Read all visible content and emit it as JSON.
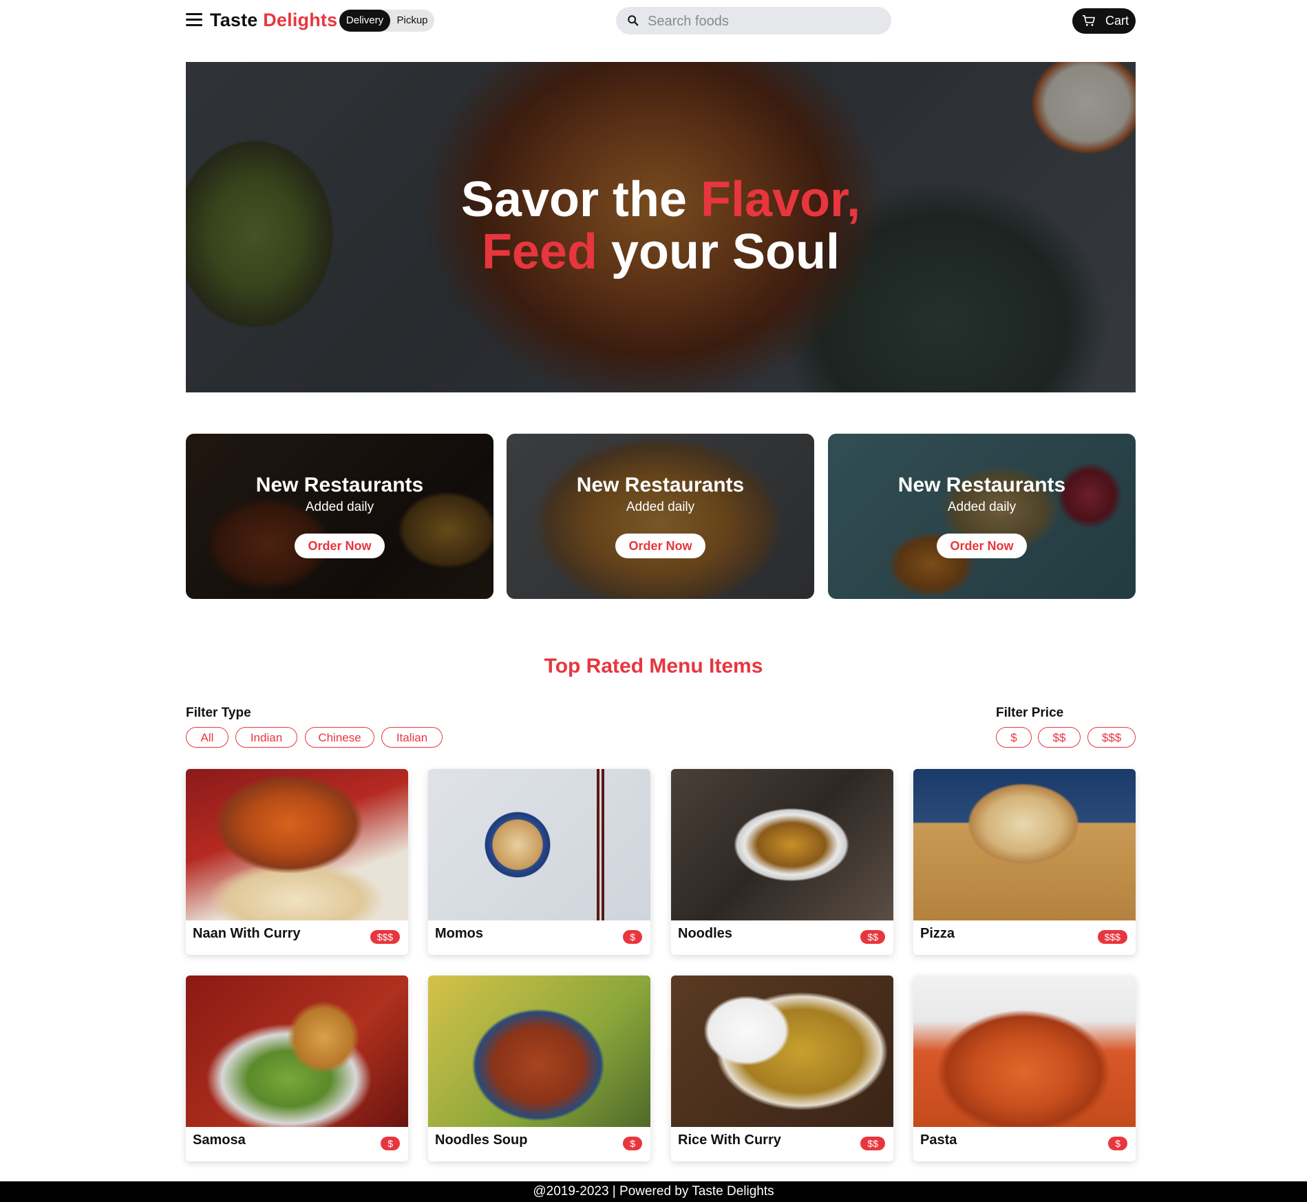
{
  "header": {
    "brand_part1": "Taste",
    "brand_part2": "Delights",
    "toggle": {
      "delivery": "Delivery",
      "pickup": "Pickup"
    },
    "search_placeholder": "Search foods",
    "cart_label": "Cart"
  },
  "hero": {
    "line1_a": "Savor the ",
    "line1_b": "Flavor,",
    "line2_a": "Feed",
    "line2_b": " your Soul"
  },
  "promos": [
    {
      "title": "New Restaurants",
      "subtitle": "Added daily",
      "button": "Order Now"
    },
    {
      "title": "New Restaurants",
      "subtitle": "Added daily",
      "button": "Order Now"
    },
    {
      "title": "New Restaurants",
      "subtitle": "Added daily",
      "button": "Order Now"
    }
  ],
  "menu": {
    "title": "Top Rated Menu Items",
    "filter_type_label": "Filter Type",
    "filter_types": [
      "All",
      "Indian",
      "Chinese",
      "Italian"
    ],
    "filter_price_label": "Filter Price",
    "filter_prices": [
      "$",
      "$$",
      "$$$"
    ],
    "items": [
      {
        "name": "Naan With Curry",
        "price": "$$$"
      },
      {
        "name": "Momos",
        "price": "$"
      },
      {
        "name": "Noodles",
        "price": "$$"
      },
      {
        "name": "Pizza",
        "price": "$$$"
      },
      {
        "name": "Samosa",
        "price": "$"
      },
      {
        "name": "Noodles Soup",
        "price": "$"
      },
      {
        "name": "Rice With Curry",
        "price": "$$"
      },
      {
        "name": "Pasta",
        "price": "$"
      }
    ]
  },
  "footer": {
    "text": "@2019-2023 | Powered by Taste Delights"
  },
  "colors": {
    "accent": "#e8363e",
    "dark": "#111111"
  }
}
